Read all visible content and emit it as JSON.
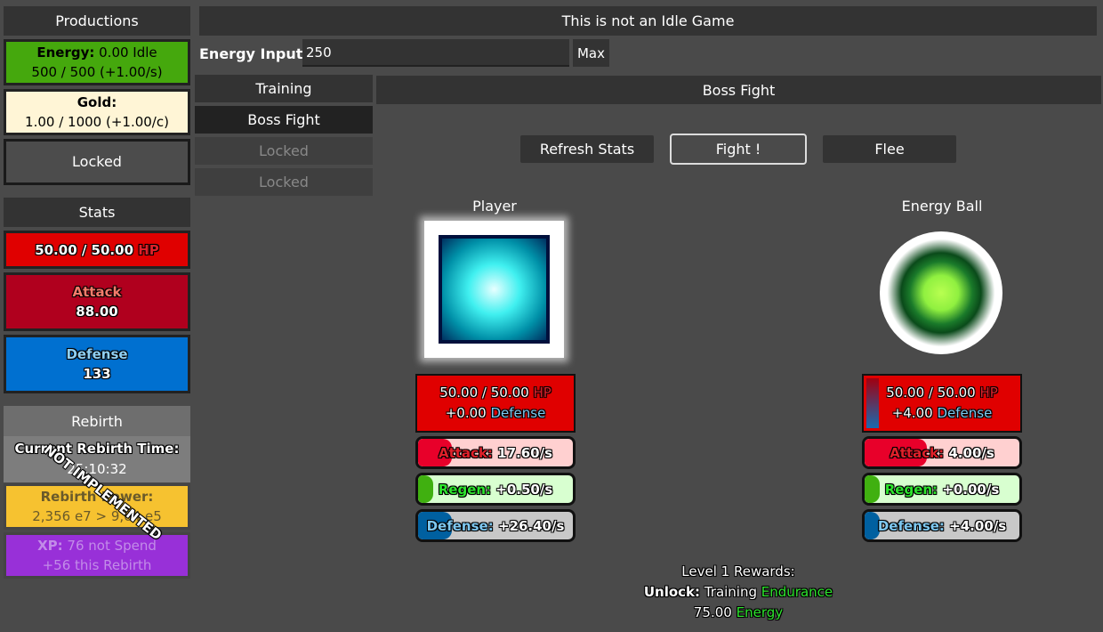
{
  "productions": {
    "title": "Productions",
    "energy_label": "Energy:",
    "energy_idle": "0.00 Idle",
    "energy_value": "500 / 500 (+1.00/s)",
    "gold_label": "Gold:",
    "gold_value": "1.00 / 1000 (+1.00/c)",
    "locked_label": "Locked"
  },
  "stats": {
    "title": "Stats",
    "hp": "50.00 / 50.00",
    "hp_suffix": "HP",
    "attack_label": "Attack",
    "attack_value": "88.00",
    "defense_label": "Defense",
    "defense_value": "133"
  },
  "rebirth": {
    "title": "Rebirth",
    "time_label": "Current Rebirth Time:",
    "time_value": "25:10:32",
    "power_label": "Rebirth Power:",
    "power_value": "2,356 e7 > 9,04 e5",
    "xp_label": "XP:",
    "xp_value": "76 not Spend",
    "xp_line2": "+56 this Rebirth",
    "overlay": "NOT IMPLEMENTED"
  },
  "header": {
    "title": "This is not an Idle Game",
    "energy_input_label": "Energy Input:",
    "energy_input_value": "250",
    "max_label": "Max"
  },
  "tabs": [
    {
      "label": "Training"
    },
    {
      "label": "Boss Fight"
    },
    {
      "label": "Locked"
    },
    {
      "label": "Locked"
    }
  ],
  "boss": {
    "title": "Boss Fight",
    "refresh_label": "Refresh Stats",
    "fight_label": "Fight !",
    "flee_label": "Flee",
    "player": {
      "name": "Player",
      "hp": "50.00 / 50.00",
      "hp_suffix": "HP",
      "def_value": "+0.00",
      "def_label": "Defense",
      "attack_label": "Attack:",
      "attack_value": "17.60/s",
      "attack_progress": 0.22,
      "regen_label": "Regen:",
      "regen_value": "+0.50/s",
      "regen_progress": 0.1,
      "defense_label": "Defense:",
      "defense_value": "+26.40/s",
      "defense_progress": 0.22
    },
    "enemy": {
      "name": "Energy Ball",
      "hp": "50.00 / 50.00",
      "hp_suffix": "HP",
      "def_value": "+4.00",
      "def_label": "Defense",
      "attack_label": "Attack:",
      "attack_value": "4.00/s",
      "attack_progress": 0.4,
      "regen_label": "Regen:",
      "regen_value": "+0.00/s",
      "regen_progress": 0.1,
      "defense_label": "Defense:",
      "defense_value": "+4.00/s",
      "defense_progress": 0.1
    },
    "rewards": {
      "title": "Level 1 Rewards:",
      "unlock_label": "Unlock:",
      "unlock_text": "Training",
      "unlock_highlight": "Endurance",
      "energy_value": "75.00",
      "energy_label": "Energy"
    }
  },
  "colors": {
    "energy_bg": "#45a80d",
    "gold_bg": "#fff5d6",
    "hp_bg": "#e00000",
    "attack_bg": "#b0001e",
    "defense_bg": "#0070d0",
    "power_bg": "#f6c230",
    "xp_bg": "#9830d8"
  }
}
